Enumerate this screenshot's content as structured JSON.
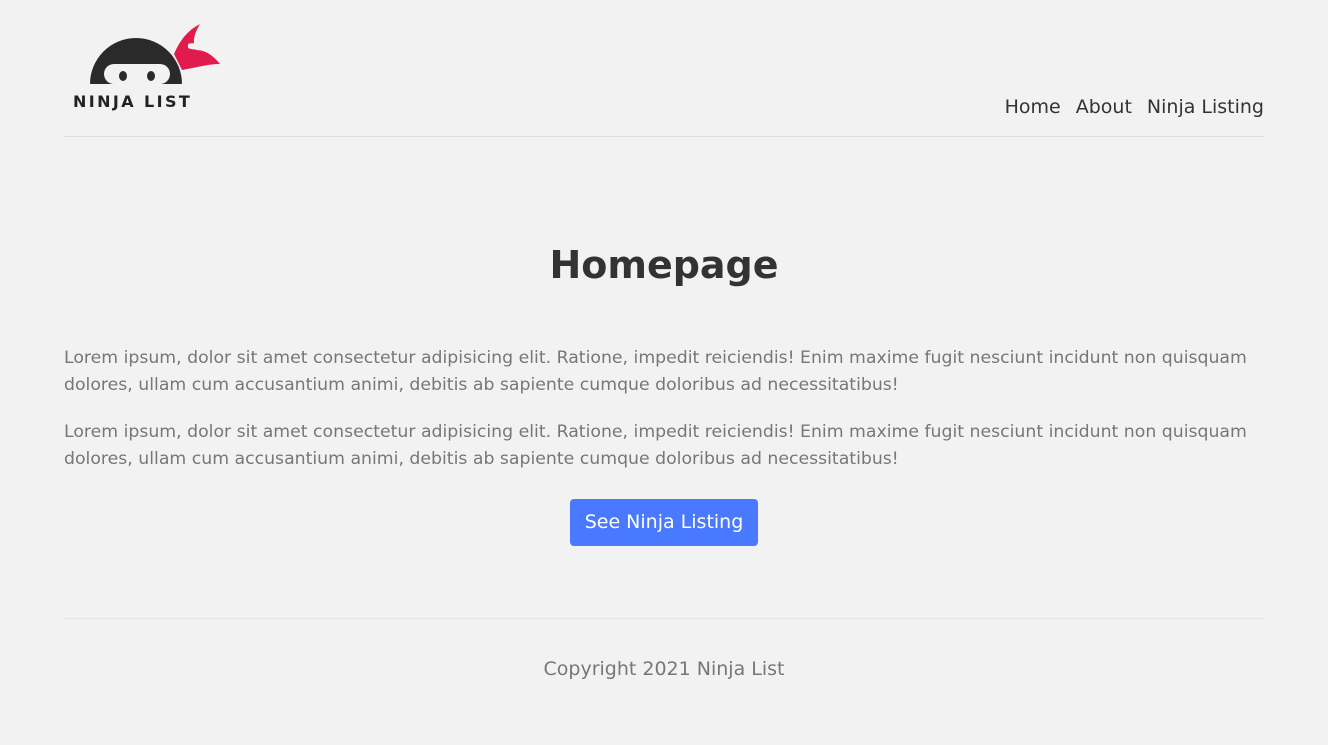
{
  "brand": {
    "logo_text": "NINJA LIST",
    "colors": {
      "logo_dark": "#2a2a2a",
      "headband": "#e21b4d"
    }
  },
  "nav": {
    "items": [
      {
        "label": "Home"
      },
      {
        "label": "About"
      },
      {
        "label": "Ninja Listing"
      }
    ]
  },
  "main": {
    "title": "Homepage",
    "paragraphs": [
      "Lorem ipsum, dolor sit amet consectetur adipisicing elit. Ratione, impedit reiciendis! Enim maxime fugit nesciunt incidunt non quisquam dolores, ullam cum accusantium animi, debitis ab sapiente cumque doloribus ad necessitatibus!",
      "Lorem ipsum, dolor sit amet consectetur adipisicing elit. Ratione, impedit reiciendis! Enim maxime fugit nesciunt incidunt non quisquam dolores, ullam cum accusantium animi, debitis ab sapiente cumque doloribus ad necessitatibus!"
    ],
    "cta_label": "See Ninja Listing",
    "cta_color": "#4979ff"
  },
  "footer": {
    "copyright": "Copyright 2021 Ninja List"
  }
}
